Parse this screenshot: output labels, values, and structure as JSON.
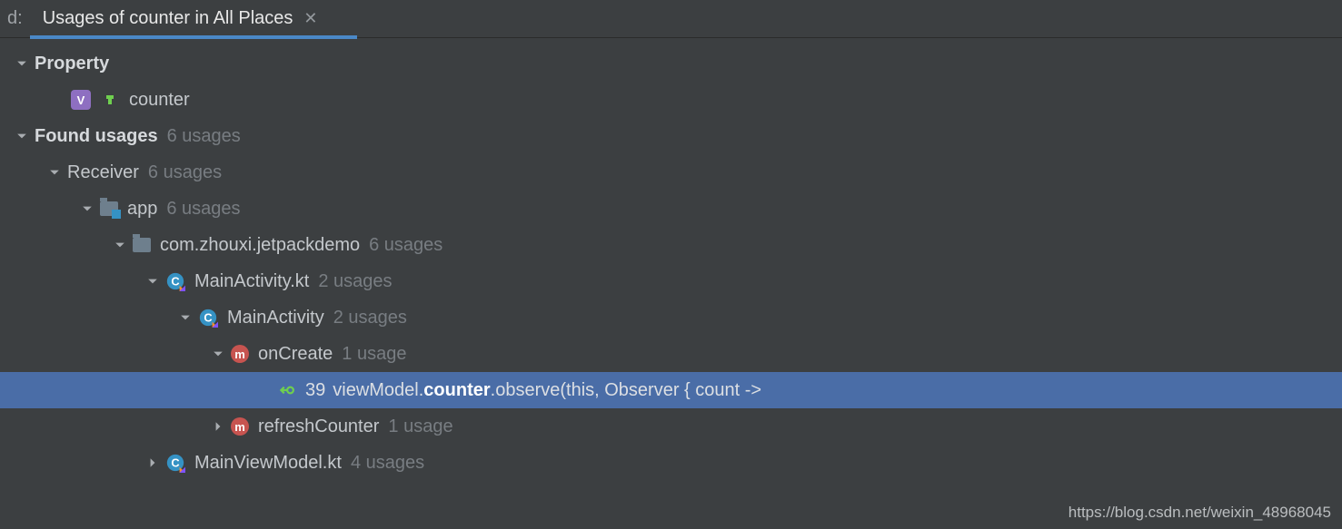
{
  "tabbar": {
    "prefix": "d:",
    "title": "Usages of counter in All Places"
  },
  "tree": {
    "property": {
      "label": "Property",
      "item": "counter"
    },
    "found": {
      "label": "Found usages",
      "count": "6 usages"
    },
    "receiver": {
      "label": "Receiver",
      "count": "6 usages"
    },
    "app": {
      "label": "app",
      "count": "6 usages"
    },
    "pkg": {
      "label": "com.zhouxi.jetpackdemo",
      "count": "6 usages"
    },
    "file1": {
      "label": "MainActivity.kt",
      "count": "2 usages"
    },
    "cls1": {
      "label": "MainActivity",
      "count": "2 usages"
    },
    "m1": {
      "label": "onCreate",
      "count": "1 usage"
    },
    "usage": {
      "line": "39",
      "pre": "viewModel.",
      "bold": "counter",
      "post": ".observe(this, Observer { count ->"
    },
    "m2": {
      "label": "refreshCounter",
      "count": "1 usage"
    },
    "file2": {
      "label": "MainViewModel.kt",
      "count": "4 usages"
    }
  },
  "watermark": "https://blog.csdn.net/weixin_48968045"
}
